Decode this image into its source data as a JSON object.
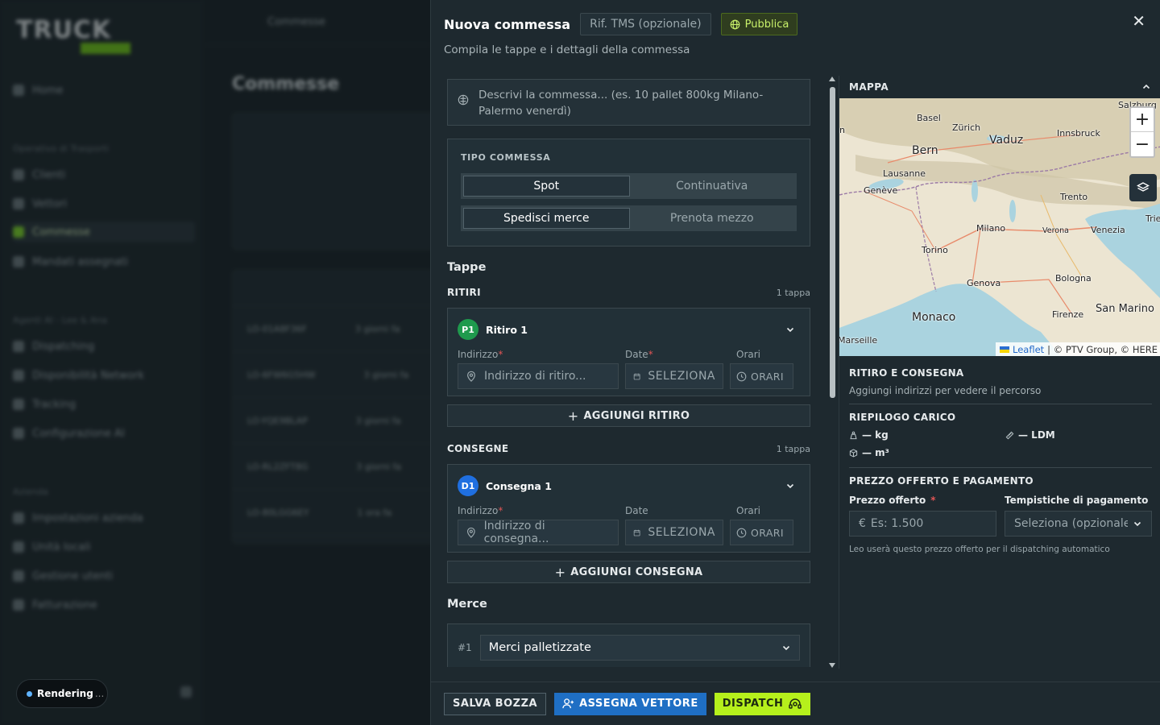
{
  "background": {
    "logo_text": "TRUCK",
    "nav": [
      {
        "label": "Home"
      },
      {
        "label": "Clienti"
      },
      {
        "label": "Vettori"
      },
      {
        "label": "Commesse"
      },
      {
        "label": "Mandati assegnati"
      },
      {
        "label": "Dispatching"
      },
      {
        "label": "Disponibilità Network"
      },
      {
        "label": "Tracking"
      },
      {
        "label": "Configurazione AI"
      },
      {
        "label": "Impostazioni azienda"
      },
      {
        "label": "Unità locali"
      },
      {
        "label": "Gestione utenti"
      },
      {
        "label": "Fatturazione"
      }
    ],
    "sections": [
      "Operativo di Trasporti",
      "Agenti AI - Lee & Ana",
      "Azienda"
    ],
    "page_title": "Commesse",
    "breadcrumb": "Commesse",
    "rows": [
      {
        "code": "LO-01A8F36F",
        "when": "3 giorni fa"
      },
      {
        "code": "LO-6FW6G5HW",
        "when": "3 giorni fa"
      },
      {
        "code": "LO-YQE9BLAP",
        "when": "3 giorni fa"
      },
      {
        "code": "LO-RL2ZFT8G",
        "when": "3 giorni fa"
      },
      {
        "code": "LO-80LGG6EY",
        "when": "1 ora fa"
      }
    ],
    "status_pill": {
      "label": "Rendering",
      "ellipsis": "..."
    }
  },
  "drawer": {
    "title": "Nuova commessa",
    "ref_placeholder": "Rif. TMS (opzionale)",
    "publish_label": "Pubblica",
    "subtitle": "Compila le tappe e i dettagli della commessa",
    "description_placeholder": "Descrivi la commessa... (es. 10 pallet 800kg Milano-Palermo venerdì)",
    "tipo": {
      "label": "TIPO COMMESSA",
      "row1": [
        "Spot",
        "Continuativa"
      ],
      "row2": [
        "Spedisci merce",
        "Prenota mezzo"
      ],
      "selected": [
        "Spot",
        "Spedisci merce"
      ]
    },
    "tappe_title": "Tappe",
    "ritiri": {
      "label": "RITIRI",
      "count": "1 tappa",
      "badge": "P1",
      "name": "Ritiro 1",
      "labels": {
        "address": "Indirizzo",
        "date": "Date",
        "time": "Orari"
      },
      "address_placeholder": "Indirizzo di ritiro...",
      "date_value": "SELEZIONA",
      "time_value": "ORARI",
      "add_label": "AGGIUNGI RITIRO"
    },
    "consegne": {
      "label": "CONSEGNE",
      "count": "1 tappa",
      "badge": "D1",
      "name": "Consegna 1",
      "labels": {
        "address": "Indirizzo",
        "date": "Date",
        "time": "Orari"
      },
      "address_placeholder": "Indirizzo di consegna...",
      "date_value": "SELEZIONA",
      "time_value": "ORARI",
      "add_label": "AGGIUNGI CONSEGNA"
    },
    "merce": {
      "title": "Merce",
      "index": "#1",
      "selected": "Merci palletizzate"
    },
    "map": {
      "title": "MAPPA",
      "zoom_in": "+",
      "zoom_out": "−",
      "attribution_link": "Leaflet",
      "attribution_text": "| © PTV Group, © HERE",
      "cities": [
        "Salzburg",
        "Basel",
        "Zürich",
        "Vaduz",
        "Innsbruck",
        "Bern",
        "Lausanne",
        "Genève",
        "Trento",
        "Trie",
        "Milano",
        "Verona",
        "Venezia",
        "Torino",
        "Genova",
        "Bologna",
        "Monaco",
        "Firenze",
        "San Marino",
        "Marseille",
        "n"
      ]
    },
    "ritiro_consegna": {
      "title": "RITIRO E CONSEGNA",
      "text": "Aggiungi indirizzi per vedere il percorso"
    },
    "carico": {
      "title": "RIEPILOGO CARICO",
      "kg": "— kg",
      "ldm": "— LDM",
      "m3": "— m³"
    },
    "prezzo": {
      "title": "PREZZO OFFERTO E PAGAMENTO",
      "price_label": "Prezzo offerto",
      "price_placeholder": "Es: 1.500",
      "currency": "€",
      "terms_label": "Tempistiche di pagamento",
      "terms_placeholder": "Seleziona (opzionale)",
      "hint": "Leo userà questo prezzo offerto per il dispatching automatico"
    },
    "footer": {
      "save": "SALVA BOZZA",
      "assign": "ASSEGNA VETTORE",
      "dispatch": "DISPATCH"
    }
  },
  "colors": {
    "accent_green": "#b6f01c",
    "assign_blue": "#1f6fc4",
    "pickup_badge": "#1f9a4d",
    "delivery_badge": "#1f6fe0",
    "required": "#e05555"
  }
}
